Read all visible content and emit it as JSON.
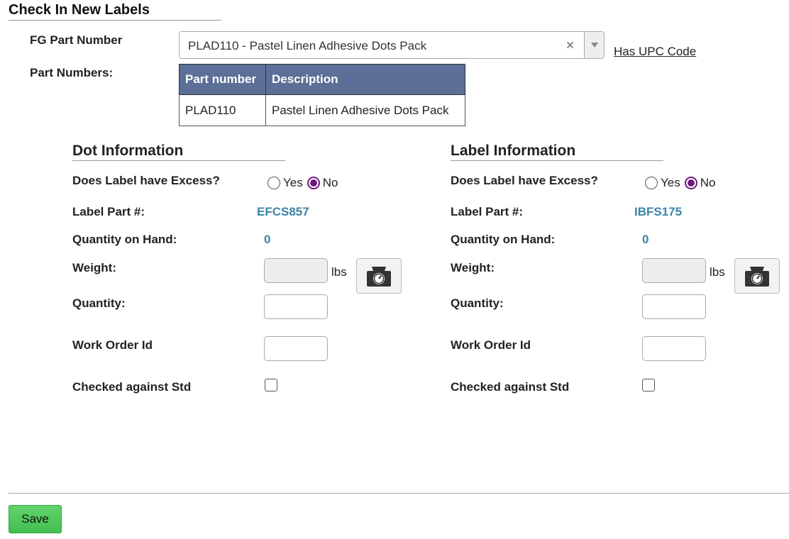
{
  "page": {
    "title": "Check In New Labels"
  },
  "fg": {
    "label": "FG Part Number",
    "selected": "PLAD110 - Pastel Linen Adhesive Dots Pack",
    "upc_link": "Has UPC Code"
  },
  "part_numbers": {
    "label": "Part Numbers:",
    "headers": [
      "Part number",
      "Description"
    ],
    "rows": [
      [
        "PLAD110",
        "Pastel Linen Adhesive Dots Pack"
      ]
    ]
  },
  "dot": {
    "title": "Dot Information",
    "excess_label": "Does Label have Excess?",
    "yes_label": "Yes",
    "no_label": "No",
    "part_label": "Label Part #:",
    "part_value": "EFCS857",
    "qoh_label": "Quantity on Hand:",
    "qoh_value": "0",
    "weight_label": "Weight:",
    "weight_unit": "lbs",
    "quantity_label": "Quantity:",
    "work_order_label": "Work Order Id",
    "checked_label": "Checked against Std"
  },
  "label": {
    "title": "Label Information",
    "excess_label": "Does Label have Excess?",
    "yes_label": "Yes",
    "no_label": "No",
    "part_label": "Label Part #:",
    "part_value": "IBFS175",
    "qoh_label": "Quantity on Hand:",
    "qoh_value": "0",
    "weight_label": "Weight:",
    "weight_unit": "lbs",
    "quantity_label": "Quantity:",
    "work_order_label": "Work Order Id",
    "checked_label": "Checked against Std"
  },
  "footer": {
    "save_label": "Save"
  },
  "colors": {
    "header_bg": "#5b6f97",
    "link_value": "#3c84a8",
    "radio_checked": "#6b1a7d",
    "save_bg": "#4cc459"
  },
  "icons": {
    "scale": "scale-icon",
    "clear": "clear-icon",
    "dropdown": "chevron-down-icon"
  }
}
